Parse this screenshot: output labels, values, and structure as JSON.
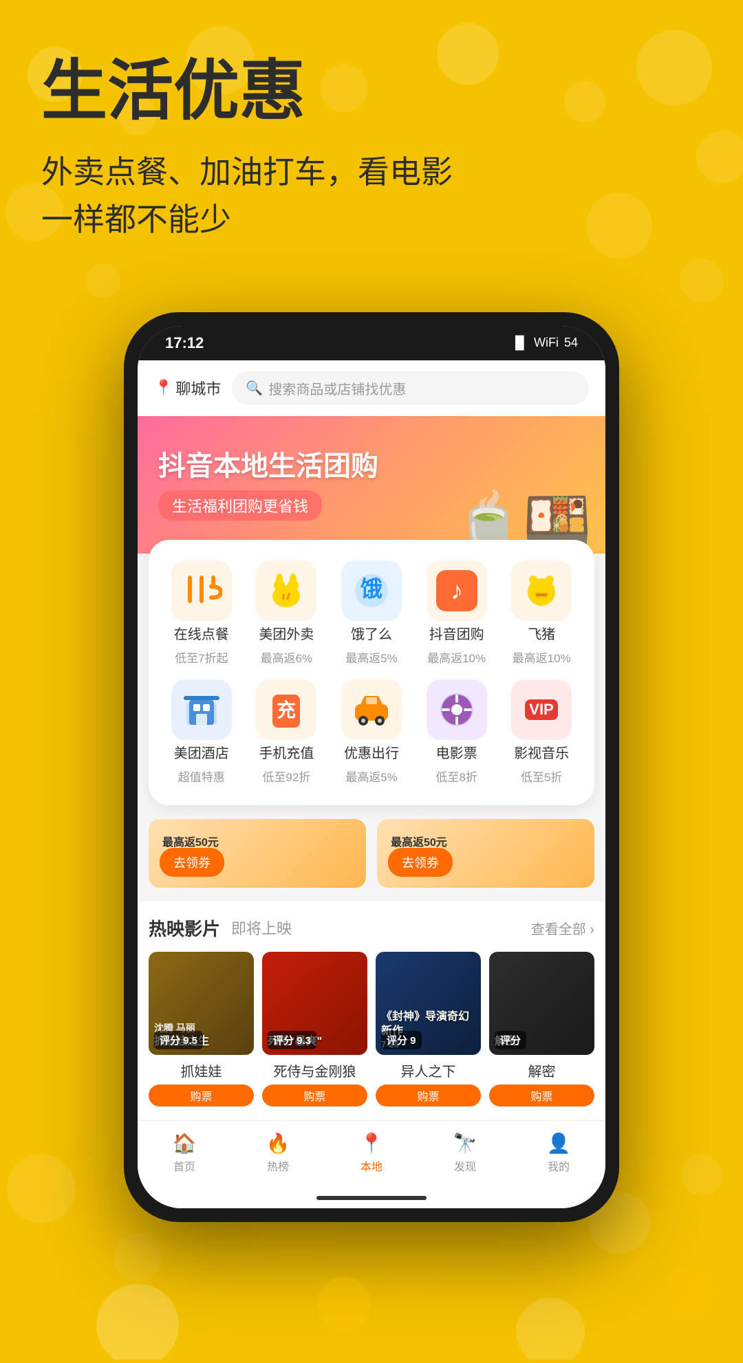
{
  "hero": {
    "title": "生活优惠",
    "subtitle_line1": "外卖点餐、加油打车，看电影",
    "subtitle_line2": "一样都不能少"
  },
  "phone": {
    "status": {
      "time": "17:12",
      "signal": "📶",
      "wifi": "📡",
      "battery": "54"
    },
    "location": "聊城市",
    "search_placeholder": "搜索商品或店铺找优惠"
  },
  "banner": {
    "title": "抖音本地生活团购",
    "subtitle": "生活福利团购更省钱"
  },
  "services": [
    {
      "id": "dining",
      "name": "在线点餐",
      "desc": "低至7折起",
      "icon": "🍽️",
      "color": "#fff5e6"
    },
    {
      "id": "meituan",
      "name": "美团外卖",
      "desc": "最高返6%",
      "icon": "🐣",
      "color": "#fff5e6"
    },
    {
      "id": "hungry",
      "name": "饿了么",
      "desc": "最高返5%",
      "icon": "🔵",
      "color": "#e8f4fd"
    },
    {
      "id": "douyin",
      "name": "抖音团购",
      "desc": "最高返10%",
      "icon": "🎵",
      "color": "#fff5e6"
    },
    {
      "id": "pig",
      "name": "飞猪",
      "desc": "最高返10%",
      "icon": "🐷",
      "color": "#fff5e6"
    },
    {
      "id": "hotel",
      "name": "美团酒店",
      "desc": "超值特惠",
      "icon": "🏨",
      "color": "#e8f0fe"
    },
    {
      "id": "charge",
      "name": "手机充值",
      "desc": "低至92折",
      "icon": "⚡",
      "color": "#fff5e6"
    },
    {
      "id": "car",
      "name": "优惠出行",
      "desc": "最高返5%",
      "icon": "🚗",
      "color": "#fff5e6"
    },
    {
      "id": "movie",
      "name": "电影票",
      "desc": "低至8折",
      "icon": "🎬",
      "color": "#f0e8fe"
    },
    {
      "id": "vip",
      "name": "影视音乐",
      "desc": "低至5折",
      "icon": "👑",
      "color": "#ffe8e8"
    }
  ],
  "movies_section": {
    "title": "热映影片",
    "subtitle": "即将上映",
    "view_all": "查看全部 ›"
  },
  "movies": [
    {
      "name": "抓娃娃",
      "actors": "沈腾 马丽",
      "rating": "评分 9.5",
      "genre_text": "抓娃娃之生"
    },
    {
      "name": "死侍与金刚狼",
      "actors": "",
      "rating": "评分 9.3",
      "genre_text": "死侍\"暴爽\""
    },
    {
      "name": "异人之下",
      "actors": "",
      "rating": "评分 9",
      "genre_text": "《封神》导演奇幻新作"
    },
    {
      "name": "解密",
      "actors": "",
      "rating": "评分",
      "genre_text": "解密"
    }
  ],
  "nav": {
    "items": [
      {
        "label": "首页",
        "icon": "🏠",
        "active": false
      },
      {
        "label": "热榜",
        "icon": "🔥",
        "active": false
      },
      {
        "label": "本地",
        "icon": "📍",
        "active": true
      },
      {
        "label": "发现",
        "icon": "🔭",
        "active": false
      },
      {
        "label": "我的",
        "icon": "👤",
        "active": false
      }
    ]
  },
  "coupon_btn_label": "去领券"
}
